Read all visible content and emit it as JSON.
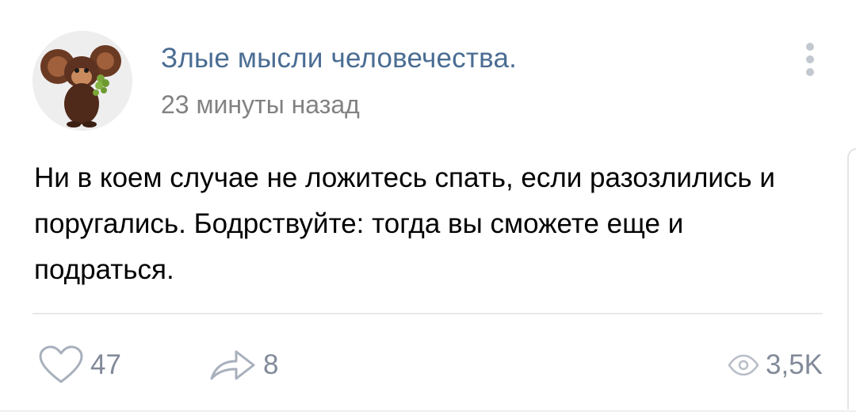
{
  "post": {
    "group_name": "Злые мысли человечества.",
    "time": "23 минуты назад",
    "text": "Ни в коем случае не ложитесь спать, если разозлились и поругались. Бодрствуйте: тогда вы сможете еще и подраться.",
    "avatar_icon": "cheburashka-avatar",
    "menu_icon": "more-vertical-icon"
  },
  "actions": {
    "likes": "47",
    "shares": "8",
    "views": "3,5K",
    "like_icon": "heart-icon",
    "share_icon": "share-arrow-icon",
    "views_icon": "eye-icon"
  },
  "colors": {
    "group_name": "#4a6d93",
    "secondary_text": "#828282",
    "action_gray": "#828a99",
    "divider": "#e7e8ec"
  }
}
